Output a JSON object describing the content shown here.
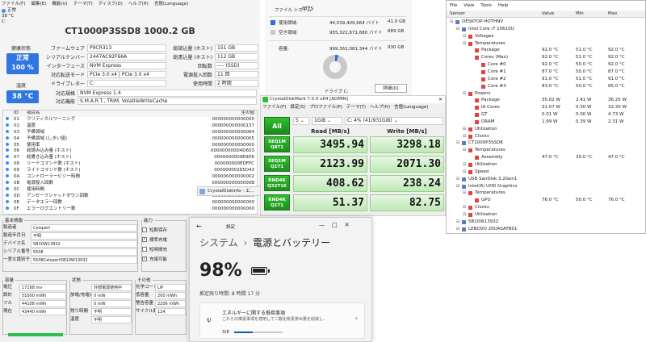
{
  "cdi": {
    "menu": [
      "ファイル(F)",
      "編集(E)",
      "機能(U)",
      "テーマ(T)",
      "ディスク(D)",
      "ヘルプ(H)",
      "言語(Language)"
    ],
    "tray": {
      "status": "正常",
      "temp": "38 °C",
      "drive": "C:"
    },
    "title": "CT1000P3SSD8 1000.2 GB",
    "health_label": "健康状態",
    "health_status": "正常",
    "health_pct": "100 %",
    "temp_label": "温度",
    "temp_value": "38 °C",
    "left_fields": [
      {
        "k": "ファームウェア",
        "v": "P9CR313"
      },
      {
        "k": "シリアルナンバー",
        "v": "2447AC92F66A"
      },
      {
        "k": "インターフェース",
        "v": "NVM Express"
      },
      {
        "k": "対応転送モード",
        "v": "PCIe 3.0 x4 | PCIe 3.0 x4"
      },
      {
        "k": "ドライブレター",
        "v": "C:"
      }
    ],
    "right_fields": [
      {
        "k": "総読込量 (ホスト)",
        "v": "151 GB"
      },
      {
        "k": "総書込量 (ホスト)",
        "v": "112 GB"
      },
      {
        "k": "回転数",
        "v": "---- (SSD)"
      },
      {
        "k": "電源投入回数",
        "v": "11 回"
      },
      {
        "k": "使用時間",
        "v": "2 時間"
      }
    ],
    "standard_label": "対応規格",
    "standard_value": "NVM Express 1.4",
    "features_label": "対応機能",
    "features_value": "S.M.A.R.T., TRIM, VolatileWriteCache",
    "table_headers": [
      "ID",
      "項目名",
      "生の値"
    ],
    "smart": [
      {
        "id": "01",
        "name": "クリティカルワーニング",
        "raw": "000000000000000"
      },
      {
        "id": "02",
        "name": "温度",
        "raw": "000000000000137"
      },
      {
        "id": "03",
        "name": "予備領域",
        "raw": "000000000000064"
      },
      {
        "id": "04",
        "name": "予備領域 (しきい値)",
        "raw": "000000000000005"
      },
      {
        "id": "05",
        "name": "使用率",
        "raw": "000000000000000"
      },
      {
        "id": "06",
        "name": "総読み込み量 (ホスト)",
        "raw": "000000000D4D603"
      },
      {
        "id": "07",
        "name": "総書き込み量 (ホスト)",
        "raw": "0000000009E9D6"
      },
      {
        "id": "08",
        "name": "リードコマンド数 (ホスト)",
        "raw": "000000000EDFFC"
      },
      {
        "id": "09",
        "name": "ライトコマンド数 (ホスト)",
        "raw": "00000000265D43"
      },
      {
        "id": "0A",
        "name": "コントローラービジー時間",
        "raw": "000000000000002"
      },
      {
        "id": "0B",
        "name": "電源投入回数",
        "raw": "00000000000000B"
      },
      {
        "id": "0C",
        "name": "使用時間",
        "raw": "000000000000002"
      },
      {
        "id": "0D",
        "name": "アンセーフシャットダウン回数",
        "raw": "000000000000000"
      },
      {
        "id": "0E",
        "name": "データエラー回数",
        "raw": "000000000000000"
      },
      {
        "id": "0F",
        "name": "エラーログエントリー数",
        "raw": "000000000000000"
      }
    ]
  },
  "cdi_mini_title": "CrystalDiskInfo - エ...",
  "battinfo": {
    "basic_title": "基本情報",
    "basic": [
      {
        "k": "製造者",
        "v": "Celxpert"
      },
      {
        "k": "製造年月日",
        "v": "不明"
      },
      {
        "k": "デバイス名",
        "v": "5B10W13932"
      },
      {
        "k": "シリアル番号",
        "v": "5508"
      },
      {
        "k": "一意な識別子",
        "v": "5508Celxpert5B10W13932"
      }
    ],
    "power_title": "能力",
    "power": [
      {
        "k": "短期保存",
        "checked": false
      },
      {
        "k": "標準充電",
        "checked": true
      },
      {
        "k": "短時間充",
        "checked": false
      },
      {
        "k": "充電可能",
        "checked": true
      }
    ],
    "cap_title": "容量",
    "cap": [
      {
        "k": "電圧",
        "v": "17198 mv"
      },
      {
        "k": "設計",
        "v": "51000 mWh"
      },
      {
        "k": "フル",
        "v": "44108 mWh"
      },
      {
        "k": "現在",
        "v": "43440 mWh"
      }
    ],
    "state_title": "状態",
    "state": [
      {
        "k": "",
        "v": "外部電源使用中"
      },
      {
        "k": "放電/充電速度",
        "v": "0 mW"
      },
      {
        "k": "",
        "v": "0 mW"
      },
      {
        "k": "残り時間",
        "v": "不明"
      },
      {
        "k": "温度",
        "v": "不明"
      }
    ],
    "other_title": "その他",
    "other": [
      {
        "k": "化学コード",
        "v": "LiP"
      },
      {
        "k": "低容量",
        "v": "200 mWh"
      },
      {
        "k": "警告容量",
        "v": "2206 mWh"
      },
      {
        "k": "サイクル数",
        "v": "124"
      }
    ]
  },
  "fileprops": {
    "fs_label": "ファイル システム:",
    "fs": "NTFS",
    "used_label": "使用領域:",
    "used_bytes": "44,039,409,664 バイト",
    "used_gb": "41.0 GB",
    "free_label": "空き領域:",
    "free_bytes": "955,321,671,680 バイト",
    "free_gb": "889 GB",
    "cap_label": "容量:",
    "cap_bytes": "999,361,081,344 バイト",
    "cap_gb": "930 GB",
    "drive_label": "ドライブ C:",
    "details_button": "詳細(D)",
    "used_fraction": 0.044
  },
  "cdm": {
    "title": "CrystalDiskMark 7.0.0 x64 [ADMIN]",
    "menu": [
      "ファイル(F)",
      "設定(S)",
      "プロファイル(P)",
      "テーマ(T)",
      "ヘルプ(H)",
      "言語(Language)"
    ],
    "all_button": "All",
    "count": "5",
    "size": "1GiB",
    "drive": "C: 4% (41/931GiB)",
    "read_header": "Read [MB/s]",
    "write_header": "Write [MB/s]",
    "tests": [
      {
        "l1": "SEQ1M",
        "l2": "Q8T1",
        "read": "3495.94",
        "write": "3298.18"
      },
      {
        "l1": "SEQ1M",
        "l2": "Q1T1",
        "read": "2123.99",
        "write": "2071.30"
      },
      {
        "l1": "RND4K",
        "l2": "Q32T16",
        "read": "408.62",
        "write": "238.24"
      },
      {
        "l1": "RND4K",
        "l2": "Q1T1",
        "read": "51.37",
        "write": "82.75"
      }
    ]
  },
  "hwinfo": {
    "menu": [
      "File",
      "View",
      "Tools",
      "Help"
    ],
    "headers": [
      "Sensor",
      "Value",
      "Min",
      "Max"
    ],
    "rows": [
      {
        "indent": 0,
        "name": "DESKTOP-HOTHNV",
        "v": "",
        "mn": "",
        "mx": ""
      },
      {
        "indent": 1,
        "name": "Intel Core i7 10610U",
        "v": "",
        "mn": "",
        "mx": ""
      },
      {
        "indent": 2,
        "name": "Voltages",
        "v": "",
        "mn": "",
        "mx": ""
      },
      {
        "indent": 2,
        "name": "Temperatures",
        "v": "",
        "mn": "",
        "mx": ""
      },
      {
        "indent": 3,
        "name": "Package",
        "v": "92.0 °C",
        "mn": "51.0 °C",
        "mx": "92.0 °C"
      },
      {
        "indent": 3,
        "name": "Cores (Max)",
        "v": "92.0 °C",
        "mn": "51.0 °C",
        "mx": "92.0 °C"
      },
      {
        "indent": 4,
        "name": "Core #0",
        "v": "92.0 °C",
        "mn": "50.0 °C",
        "mx": "92.0 °C"
      },
      {
        "indent": 4,
        "name": "Core #1",
        "v": "87.0 °C",
        "mn": "50.0 °C",
        "mx": "87.0 °C"
      },
      {
        "indent": 4,
        "name": "Core #2",
        "v": "91.0 °C",
        "mn": "51.0 °C",
        "mx": "91.0 °C"
      },
      {
        "indent": 4,
        "name": "Core #3",
        "v": "83.0 °C",
        "mn": "50.0 °C",
        "mx": "85.0 °C"
      },
      {
        "indent": 2,
        "name": "Powers",
        "v": "",
        "mn": "",
        "mx": ""
      },
      {
        "indent": 3,
        "name": "Package",
        "v": "35.02 W",
        "mn": "2.41 W",
        "mx": "36.25 W"
      },
      {
        "indent": 3,
        "name": "IA Cores",
        "v": "31.07 W",
        "mn": "0.30 W",
        "mx": "32.30 W"
      },
      {
        "indent": 3,
        "name": "GT",
        "v": "0.01 W",
        "mn": "0.00 W",
        "mx": "4.73 W"
      },
      {
        "indent": 3,
        "name": "DRAM",
        "v": "1.99 W",
        "mn": "0.39 W",
        "mx": "2.31 W"
      },
      {
        "indent": 2,
        "name": "Utilization",
        "v": "",
        "mn": "",
        "mx": ""
      },
      {
        "indent": 2,
        "name": "Clocks",
        "v": "",
        "mn": "",
        "mx": ""
      },
      {
        "indent": 1,
        "name": "CT1000P3SSD8",
        "v": "",
        "mn": "",
        "mx": ""
      },
      {
        "indent": 2,
        "name": "Temperatures",
        "v": "",
        "mn": "",
        "mx": ""
      },
      {
        "indent": 3,
        "name": "Assembly",
        "v": "47.0 °C",
        "mn": "39.0 °C",
        "mx": "47.0 °C"
      },
      {
        "indent": 2,
        "name": "Utilization",
        "v": "",
        "mn": "",
        "mx": ""
      },
      {
        "indent": 2,
        "name": "Speed",
        "v": "",
        "mn": "",
        "mx": ""
      },
      {
        "indent": 1,
        "name": "USB SanDisk 3.2Gen1",
        "v": "",
        "mn": "",
        "mx": ""
      },
      {
        "indent": 1,
        "name": "Intel(R) UHD Graphics",
        "v": "",
        "mn": "",
        "mx": ""
      },
      {
        "indent": 2,
        "name": "Temperatures",
        "v": "",
        "mn": "",
        "mx": ""
      },
      {
        "indent": 3,
        "name": "GPU",
        "v": "76.0 °C",
        "mn": "50.0 °C",
        "mx": "76.0 °C"
      },
      {
        "indent": 2,
        "name": "Clocks",
        "v": "",
        "mn": "",
        "mx": ""
      },
      {
        "indent": 2,
        "name": "Utilization",
        "v": "",
        "mn": "",
        "mx": ""
      },
      {
        "indent": 1,
        "name": "5B10W13932",
        "v": "",
        "mn": "",
        "mx": ""
      },
      {
        "indent": 1,
        "name": "LENOVO 20UASATB01",
        "v": "",
        "mn": "",
        "mx": ""
      }
    ]
  },
  "battery": {
    "settings_label": "設定",
    "breadcrumb_parent": "システム",
    "breadcrumb_sep": "›",
    "breadcrumb_current": "電源とバッテリー",
    "percent": "98%",
    "remaining": "推定残り時間: 8 時間 17 分",
    "rec_title": "エネルギーに関する推奨事項",
    "rec_desc": "これらの推奨事項を適用して二酸化炭素排出量を削減し、",
    "rec_progress": "3/8",
    "rec_fraction": 0.375
  }
}
